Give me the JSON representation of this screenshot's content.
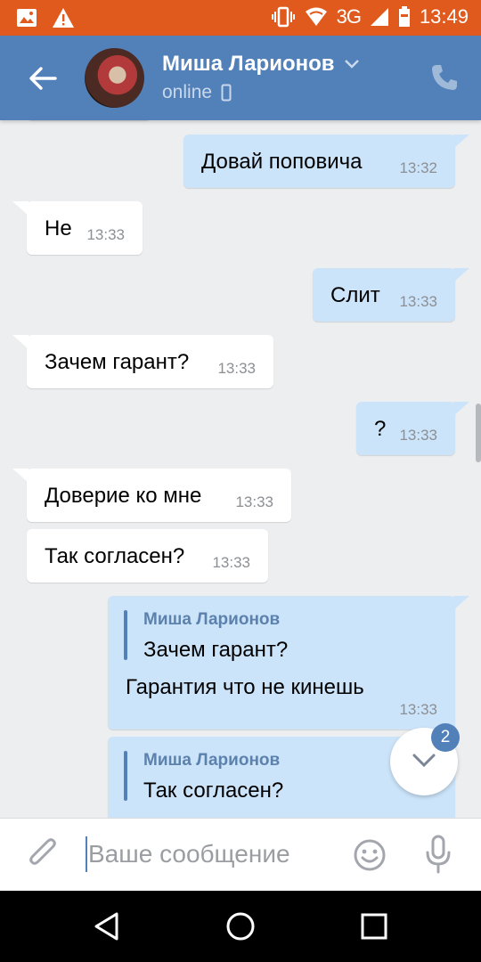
{
  "status_bar": {
    "network": "3G",
    "time": "13:49",
    "colors": {
      "background": "#e05a1e"
    }
  },
  "header": {
    "contact_name": "Миша Ларионов",
    "presence": "online",
    "colors": {
      "background": "#5181b8"
    }
  },
  "messages": [
    {
      "direction": "out",
      "text": "Довай поповича",
      "time": "13:32"
    },
    {
      "direction": "in",
      "text": "Не",
      "time": "13:33"
    },
    {
      "direction": "out",
      "text": "Слит",
      "time": "13:33"
    },
    {
      "direction": "in",
      "text": "Зачем гарант?",
      "time": "13:33"
    },
    {
      "direction": "out",
      "text": "?",
      "time": "13:33"
    },
    {
      "direction": "in",
      "text": "Доверие ко мне",
      "time": "13:33"
    },
    {
      "direction": "in",
      "text": "Так согласен?",
      "time": "13:33"
    },
    {
      "direction": "out",
      "quote_author": "Миша Ларионов",
      "quote_text": "Зачем гарант?",
      "text": "Гарантия что не кинешь",
      "time": "13:33"
    },
    {
      "direction": "out",
      "quote_author": "Миша Ларионов",
      "quote_text": "Так согласен?"
    }
  ],
  "scroll_down": {
    "unread_count": "2"
  },
  "composer": {
    "placeholder": "Ваше сообщение"
  },
  "icons": [
    "image-icon",
    "warning-icon",
    "vibrate-icon",
    "wifi-icon",
    "signal-icon",
    "battery-icon",
    "back-arrow-icon",
    "chevron-down-icon",
    "phone-icon",
    "attach-icon",
    "smile-icon",
    "mic-icon",
    "nav-back-icon",
    "nav-home-icon",
    "nav-recents-icon"
  ],
  "colors": {
    "incoming_bubble": "#ffffff",
    "outgoing_bubble": "#cce4fa",
    "chat_background": "#edeef0",
    "accent": "#5181b8"
  }
}
